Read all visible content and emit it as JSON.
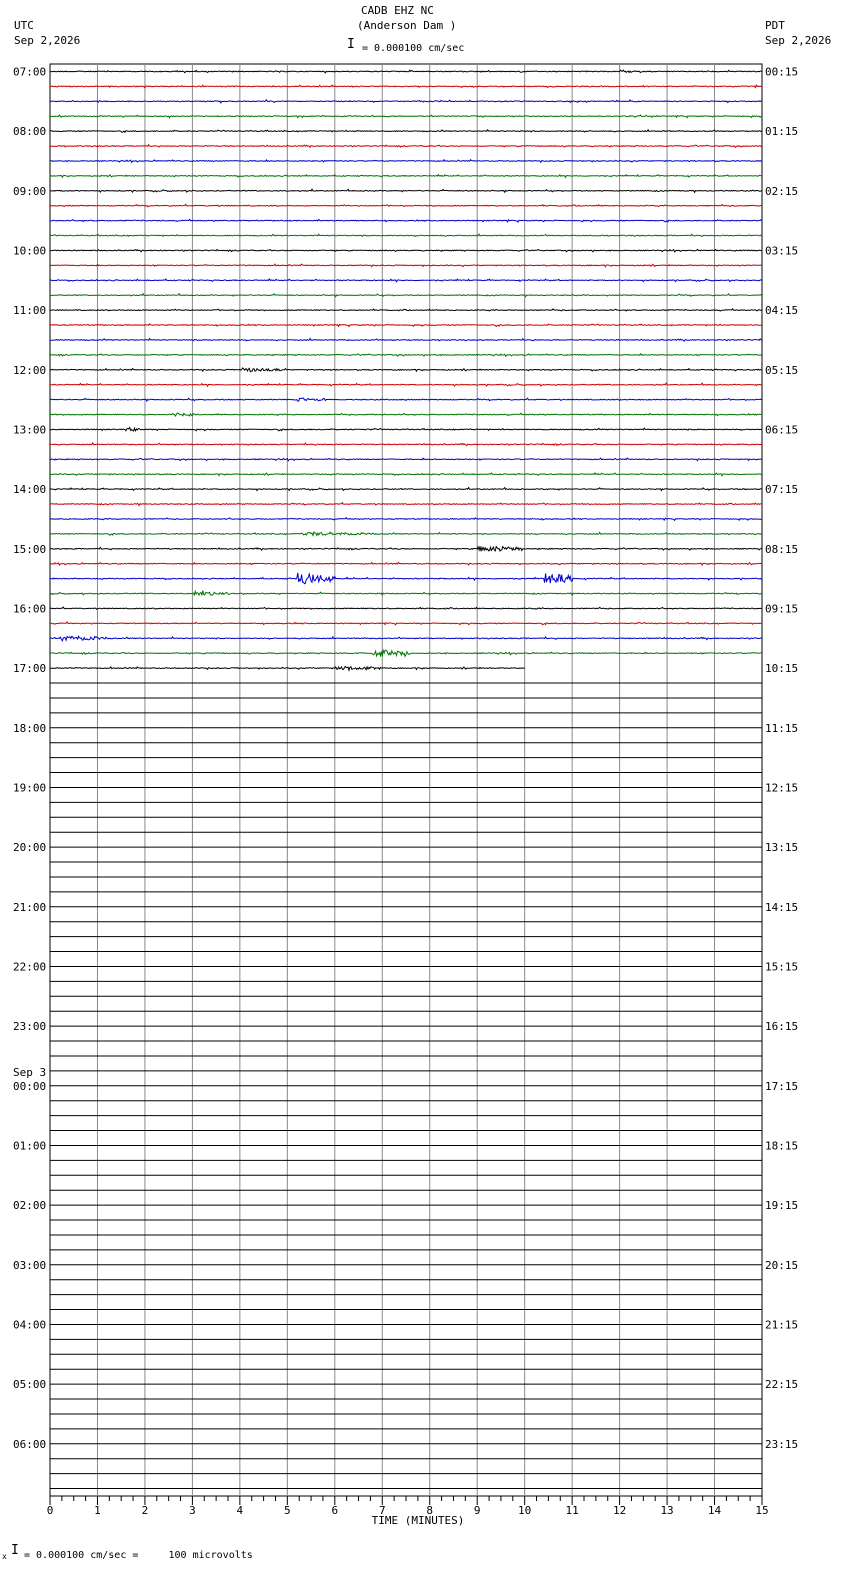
{
  "header": {
    "station": "CADB EHZ NC",
    "site": "(Anderson Dam )",
    "scale_text": "= 0.000100 cm/sec",
    "left_tz": "UTC",
    "left_date": "Sep 2,2026",
    "right_tz": "PDT",
    "right_date": "Sep 2,2026"
  },
  "footer": {
    "scale_note": "= 0.000100 cm/sec =     100 microvolts"
  },
  "chart_data": {
    "type": "line",
    "title": "CADB EHZ NC (Anderson Dam )",
    "xlabel": "TIME (MINUTES)",
    "xlim": [
      0,
      15
    ],
    "x_ticks": [
      "0",
      "1",
      "2",
      "3",
      "4",
      "5",
      "6",
      "7",
      "8",
      "9",
      "10",
      "11",
      "12",
      "13",
      "14",
      "15"
    ],
    "left_day_change": "Sep 3",
    "left_hour_labels": [
      "07:00",
      "08:00",
      "09:00",
      "10:00",
      "11:00",
      "12:00",
      "13:00",
      "14:00",
      "15:00",
      "16:00",
      "17:00",
      "18:00",
      "19:00",
      "20:00",
      "21:00",
      "22:00",
      "23:00",
      "00:00",
      "01:00",
      "02:00",
      "03:00",
      "04:00",
      "05:00",
      "06:00"
    ],
    "right_hour_labels": [
      "00:15",
      "01:15",
      "02:15",
      "03:15",
      "04:15",
      "05:15",
      "06:15",
      "07:15",
      "08:15",
      "09:15",
      "10:15",
      "11:15",
      "12:15",
      "13:15",
      "14:15",
      "15:15",
      "16:15",
      "17:15",
      "18:15",
      "19:15",
      "20:15",
      "21:15",
      "22:15",
      "23:15"
    ],
    "trace_colors": [
      "#000000",
      "#cc0000",
      "#0000cc",
      "#007700"
    ],
    "rows_total": 96,
    "rows_with_signal": 41,
    "last_row_end_minute": 10,
    "events": [
      {
        "row": 20,
        "minute": 4.0,
        "duration": 0.9,
        "amplitude": 2
      },
      {
        "row": 22,
        "minute": 5.2,
        "duration": 0.6,
        "amplitude": 2
      },
      {
        "row": 23,
        "minute": 2.6,
        "duration": 0.5,
        "amplitude": 1.5
      },
      {
        "row": 24,
        "minute": 1.6,
        "duration": 0.3,
        "amplitude": 2
      },
      {
        "row": 31,
        "minute": 5.3,
        "duration": 1.5,
        "amplitude": 2
      },
      {
        "row": 32,
        "minute": 9.0,
        "duration": 1.0,
        "amplitude": 3
      },
      {
        "row": 34,
        "minute": 5.2,
        "duration": 0.8,
        "amplitude": 6
      },
      {
        "row": 34,
        "minute": 10.4,
        "duration": 0.6,
        "amplitude": 6
      },
      {
        "row": 35,
        "minute": 3.0,
        "duration": 0.8,
        "amplitude": 2
      },
      {
        "row": 38,
        "minute": 0.2,
        "duration": 1.0,
        "amplitude": 3
      },
      {
        "row": 39,
        "minute": 6.8,
        "duration": 0.8,
        "amplitude": 4
      },
      {
        "row": 40,
        "minute": 6.0,
        "duration": 1.0,
        "amplitude": 2
      }
    ]
  }
}
